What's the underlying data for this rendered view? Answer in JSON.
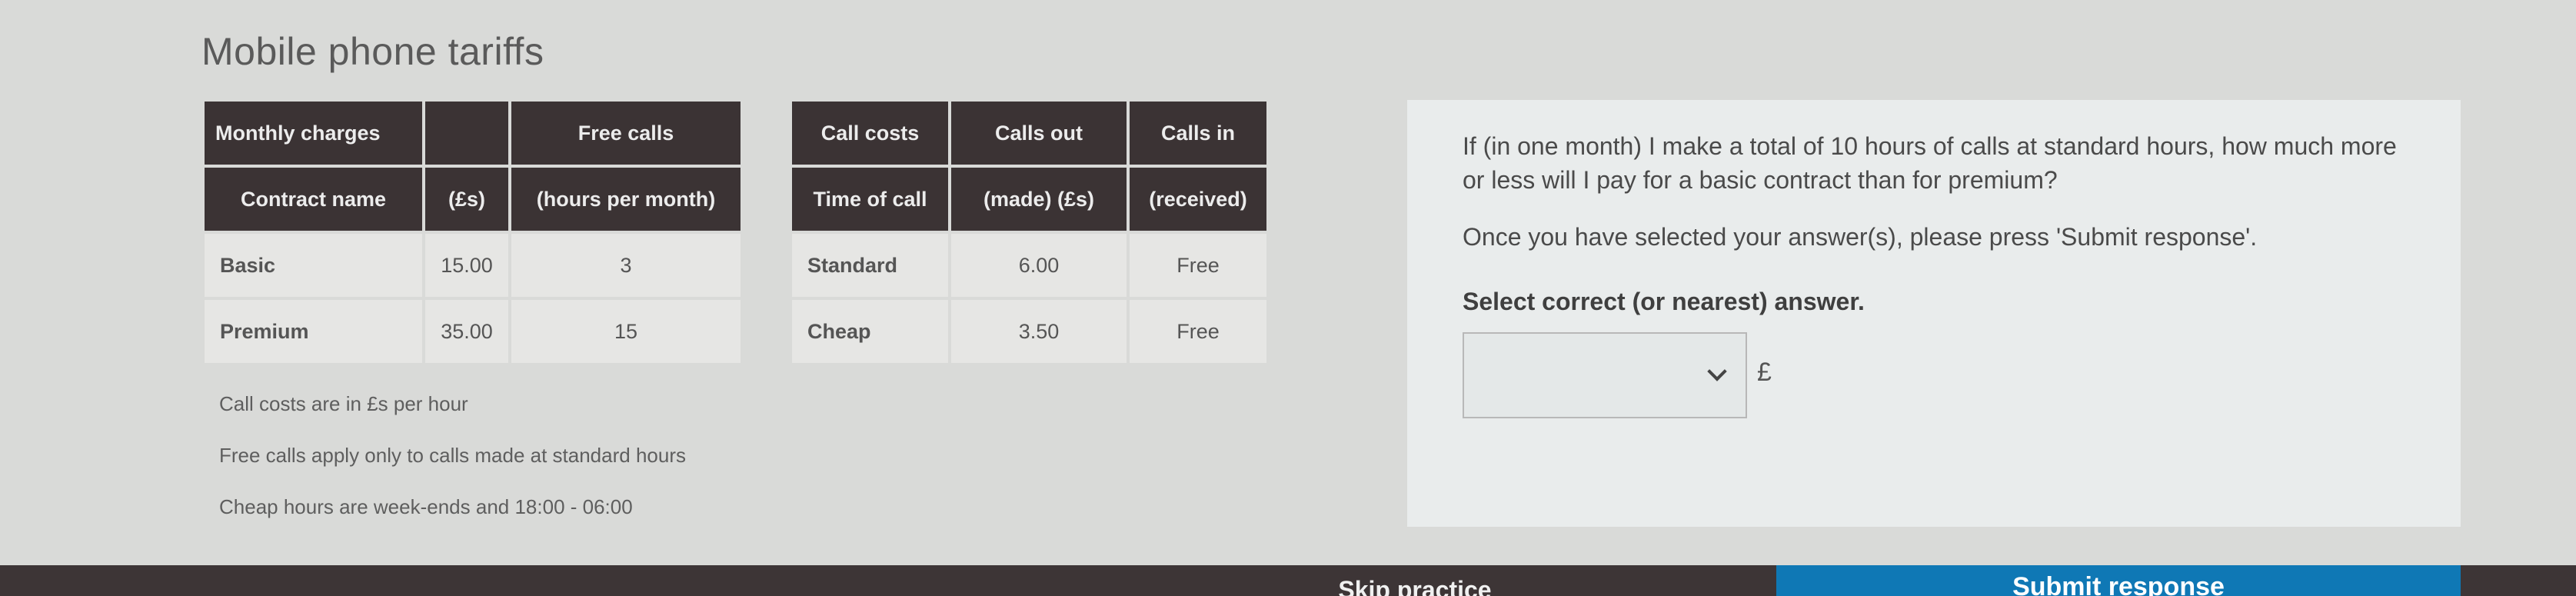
{
  "page": {
    "title": "Mobile phone tariffs"
  },
  "monthly_table": {
    "header_row1": [
      "Monthly charges",
      "",
      "Free calls"
    ],
    "header_row2": [
      "Contract name",
      "(£s)",
      "(hours per month)"
    ],
    "rows": [
      [
        "Basic",
        "15.00",
        "3"
      ],
      [
        "Premium",
        "35.00",
        "15"
      ]
    ]
  },
  "call_costs_table": {
    "header_row1": [
      "Call costs",
      "Calls out",
      "Calls in"
    ],
    "header_row2": [
      "Time of call",
      "(made) (£s)",
      "(received)"
    ],
    "rows": [
      [
        "Standard",
        "6.00",
        "Free"
      ],
      [
        "Cheap",
        "3.50",
        "Free"
      ]
    ]
  },
  "notes": [
    "Call costs are in £s per hour",
    "Free calls apply only to calls made at standard hours",
    "Cheap hours are week-ends and 18:00 - 06:00"
  ],
  "question": {
    "text": "If (in one month) I make a total of 10 hours of calls at standard hours, how much more or less will I pay for a basic contract than for premium?",
    "instruction": "Once you have selected your answer(s), please press 'Submit response'.",
    "prompt": "Select correct (or nearest) answer.",
    "select_value": "",
    "currency_symbol": "£"
  },
  "footer": {
    "skip_label": "Skip practice",
    "submit_label": "Submit response"
  },
  "colors": {
    "header_bg": "#3b3334",
    "submit_bg": "#0f78b5",
    "bar_bg": "#3d3536"
  }
}
